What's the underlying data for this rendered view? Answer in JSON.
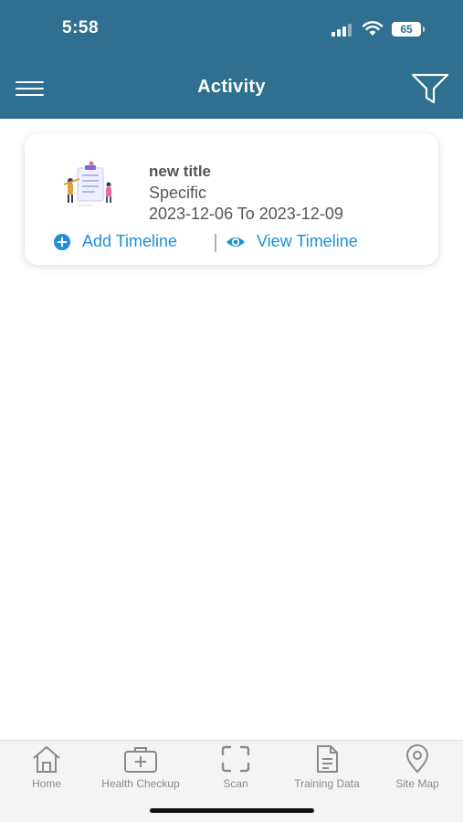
{
  "status_bar": {
    "time": "5:58",
    "battery_level": "65"
  },
  "header": {
    "title": "Activity",
    "menu_icon": "hamburger-menu-icon",
    "filter_icon": "filter-funnel-icon",
    "background_color": "#2f6f8f"
  },
  "activities": [
    {
      "title": "new title",
      "type": "Specific",
      "date_range": "2023-12-06 To 2023-12-09",
      "add_timeline_label": "Add Timeline",
      "view_timeline_label": "View Timeline"
    }
  ],
  "accent_color": "#1e8fd8",
  "tabbar": {
    "tabs": [
      {
        "label": "Home",
        "icon": "home-icon"
      },
      {
        "label": "Health Checkup",
        "icon": "medical-kit-icon"
      },
      {
        "label": "Scan",
        "icon": "scan-frame-icon"
      },
      {
        "label": "Training Data",
        "icon": "document-icon"
      },
      {
        "label": "Site Map",
        "icon": "map-pin-icon"
      }
    ]
  }
}
